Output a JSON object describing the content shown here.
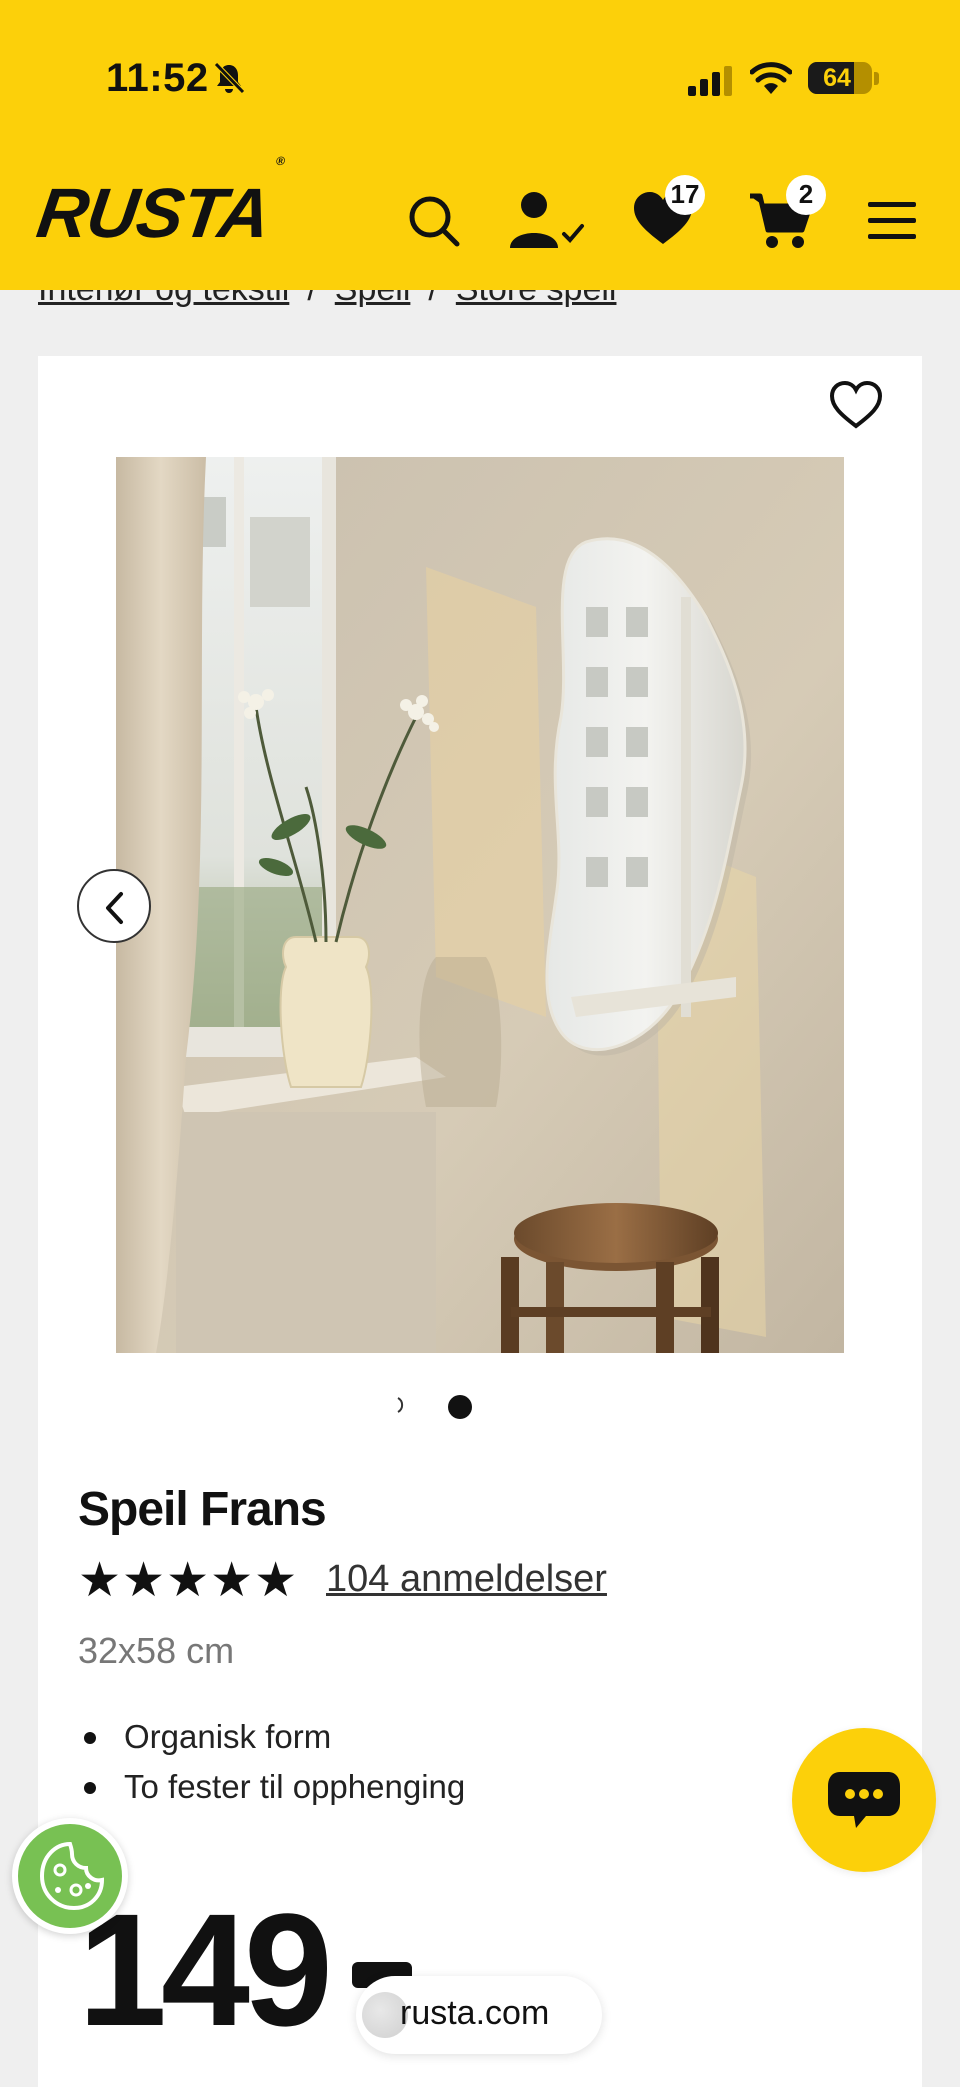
{
  "status_bar": {
    "time": "11:52",
    "battery": "64"
  },
  "header": {
    "logo": "RUSTA",
    "logo_mark": "®",
    "wishlist_count": "17",
    "cart_count": "2"
  },
  "breadcrumb": [
    "Interiør og tekstil",
    "Speil",
    "Store speil"
  ],
  "product": {
    "name": "Speil Frans",
    "stars": "★★★★★",
    "reviews": "104 anmeldelser",
    "size": "32x58 cm",
    "features": [
      "Organisk form",
      "To fester til opphenging"
    ],
    "price": "149"
  },
  "browser": {
    "url": "rusta.com"
  },
  "colors": {
    "brand_yellow": "#fcd00a",
    "cookie_green": "#78c153"
  }
}
